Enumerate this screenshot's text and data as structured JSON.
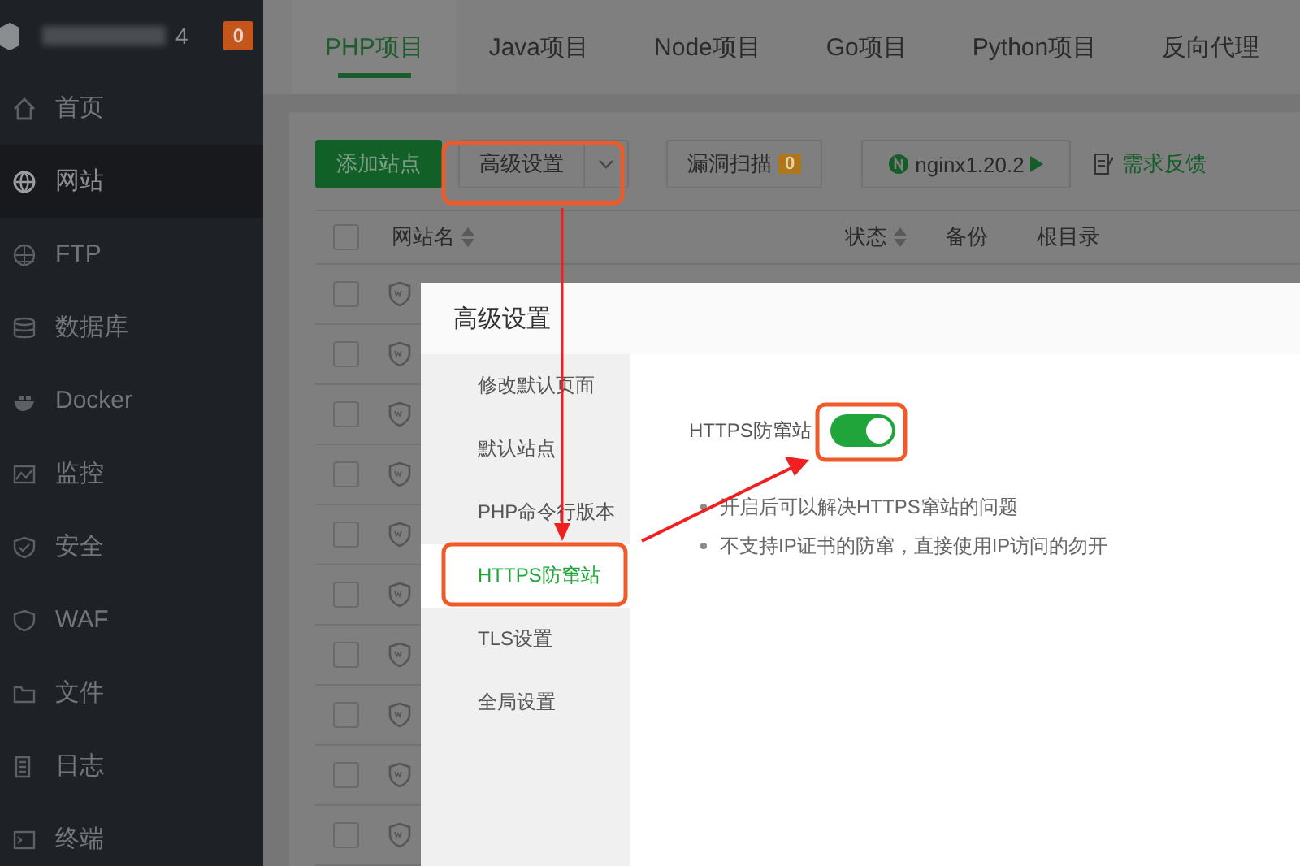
{
  "sidebar": {
    "user": {
      "name_tail": "4",
      "badge": "0"
    },
    "items": [
      {
        "label": "首页",
        "selected": false
      },
      {
        "label": "网站",
        "selected": true
      },
      {
        "label": "FTP",
        "selected": false
      },
      {
        "label": "数据库",
        "selected": false
      },
      {
        "label": "Docker",
        "selected": false
      },
      {
        "label": "监控",
        "selected": false
      },
      {
        "label": "安全",
        "selected": false
      },
      {
        "label": "WAF",
        "selected": false
      },
      {
        "label": "文件",
        "selected": false
      },
      {
        "label": "日志",
        "selected": false
      },
      {
        "label": "终端",
        "selected": false
      }
    ]
  },
  "tabs": [
    {
      "label": "PHP项目",
      "selected": true
    },
    {
      "label": "Java项目",
      "selected": false
    },
    {
      "label": "Node项目",
      "selected": false
    },
    {
      "label": "Go项目",
      "selected": false
    },
    {
      "label": "Python项目",
      "selected": false
    },
    {
      "label": "反向代理",
      "selected": false
    }
  ],
  "toolbar": {
    "add_site": "添加站点",
    "advanced": "高级设置",
    "scan": {
      "label": "漏洞扫描",
      "count": "0"
    },
    "nginx": "nginx1.20.2",
    "feedback": "需求反馈"
  },
  "table": {
    "header_checked": false,
    "columns": [
      {
        "label": "网站名",
        "sortable": true
      },
      {
        "label": "状态",
        "sortable": true
      },
      {
        "label": "备份",
        "sortable": false
      },
      {
        "label": "根目录",
        "sortable": false
      }
    ],
    "rows": [
      {
        "checked": false
      },
      {
        "checked": false
      },
      {
        "checked": false
      },
      {
        "checked": false
      },
      {
        "checked": false
      },
      {
        "checked": false
      },
      {
        "checked": false
      },
      {
        "checked": false
      },
      {
        "checked": false
      },
      {
        "checked": false
      }
    ]
  },
  "dialog": {
    "title": "高级设置",
    "nav": [
      {
        "label": "修改默认页面",
        "selected": false
      },
      {
        "label": "默认站点",
        "selected": false
      },
      {
        "label": "PHP命令行版本",
        "selected": false
      },
      {
        "label": "HTTPS防窜站",
        "selected": true
      },
      {
        "label": "TLS设置",
        "selected": false
      },
      {
        "label": "全局设置",
        "selected": false
      }
    ],
    "setting": {
      "label": "HTTPS防窜站",
      "on": true
    },
    "notes": [
      "开启后可以解决HTTPS窜站的问题",
      "不支持IP证书的防窜，直接使用IP访问的勿开"
    ]
  }
}
